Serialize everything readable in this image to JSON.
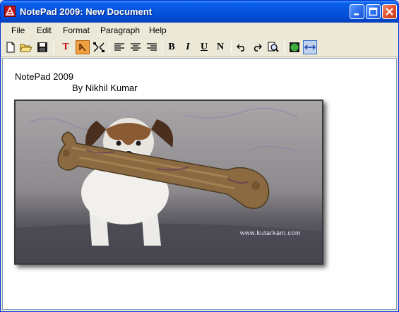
{
  "window": {
    "title": "NotePad 2009: New Document"
  },
  "menu": {
    "items": [
      "File",
      "Edit",
      "Format",
      "Paragraph",
      "Help"
    ]
  },
  "toolbar": {
    "tools": [
      {
        "name": "new-file-icon",
        "glyph": ""
      },
      {
        "name": "open-folder-icon",
        "glyph": ""
      },
      {
        "name": "save-icon",
        "glyph": ""
      },
      {
        "name": "font-color-icon",
        "glyph": "T"
      },
      {
        "name": "highlight-icon",
        "glyph": ""
      },
      {
        "name": "resize-icon",
        "glyph": ""
      },
      {
        "name": "align-left-icon",
        "glyph": ""
      },
      {
        "name": "align-center-icon",
        "glyph": ""
      },
      {
        "name": "align-right-icon",
        "glyph": ""
      },
      {
        "name": "bold-icon",
        "glyph": "B"
      },
      {
        "name": "italic-icon",
        "glyph": "I"
      },
      {
        "name": "underline-icon",
        "glyph": "U"
      },
      {
        "name": "normal-icon",
        "glyph": "N"
      },
      {
        "name": "undo-icon",
        "glyph": ""
      },
      {
        "name": "redo-icon",
        "glyph": ""
      },
      {
        "name": "find-icon",
        "glyph": ""
      },
      {
        "name": "background-color-icon",
        "glyph": ""
      },
      {
        "name": "word-wrap-icon",
        "glyph": ""
      }
    ]
  },
  "document": {
    "line1": "NotePad 2009",
    "line2": "By Nikhil Kumar",
    "image_caption": "www.kutarkam.com"
  },
  "colors": {
    "title_bar": "#0757e0",
    "close_button": "#e0502c",
    "font_color_icon": "#c01010"
  }
}
